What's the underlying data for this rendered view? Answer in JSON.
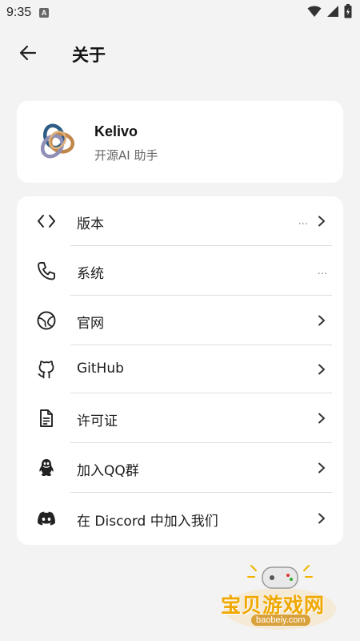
{
  "status_bar": {
    "time": "9:35",
    "a_badge": "A"
  },
  "header": {
    "title": "关于"
  },
  "app_info": {
    "name": "Kelivo",
    "description": "开源AI 助手"
  },
  "items": [
    {
      "label": "版本",
      "trailing": "...",
      "icon": "code-icon",
      "chevron": true
    },
    {
      "label": "系统",
      "trailing": "...",
      "icon": "phone-icon",
      "chevron": false
    },
    {
      "label": "官网",
      "trailing": "",
      "icon": "globe-icon",
      "chevron": true
    },
    {
      "label": "GitHub",
      "trailing": "",
      "icon": "github-icon",
      "chevron": true
    },
    {
      "label": "许可证",
      "trailing": "",
      "icon": "document-icon",
      "chevron": true
    },
    {
      "label": "加入QQ群",
      "trailing": "",
      "icon": "qq-icon",
      "chevron": true
    },
    {
      "label": "在 Discord 中加入我们",
      "trailing": "",
      "icon": "discord-icon",
      "chevron": true
    }
  ],
  "watermark": {
    "text": "宝贝游戏网",
    "url": "baobeiy.com"
  }
}
